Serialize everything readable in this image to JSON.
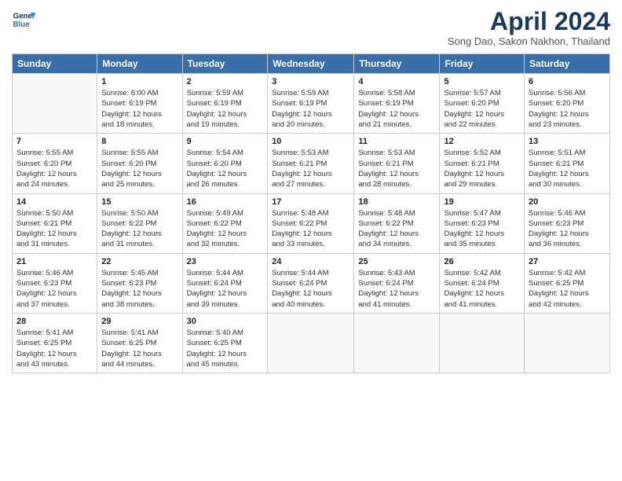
{
  "logo": {
    "line1": "General",
    "line2": "Blue"
  },
  "title": "April 2024",
  "subtitle": "Song Dao, Sakon Nakhon, Thailand",
  "days_of_week": [
    "Sunday",
    "Monday",
    "Tuesday",
    "Wednesday",
    "Thursday",
    "Friday",
    "Saturday"
  ],
  "weeks": [
    [
      {
        "day": "",
        "info": ""
      },
      {
        "day": "1",
        "info": "Sunrise: 6:00 AM\nSunset: 6:19 PM\nDaylight: 12 hours\nand 18 minutes."
      },
      {
        "day": "2",
        "info": "Sunrise: 5:59 AM\nSunset: 6:19 PM\nDaylight: 12 hours\nand 19 minutes."
      },
      {
        "day": "3",
        "info": "Sunrise: 5:59 AM\nSunset: 6:19 PM\nDaylight: 12 hours\nand 20 minutes."
      },
      {
        "day": "4",
        "info": "Sunrise: 5:58 AM\nSunset: 6:19 PM\nDaylight: 12 hours\nand 21 minutes."
      },
      {
        "day": "5",
        "info": "Sunrise: 5:57 AM\nSunset: 6:20 PM\nDaylight: 12 hours\nand 22 minutes."
      },
      {
        "day": "6",
        "info": "Sunrise: 5:56 AM\nSunset: 6:20 PM\nDaylight: 12 hours\nand 23 minutes."
      }
    ],
    [
      {
        "day": "7",
        "info": "Sunrise: 5:55 AM\nSunset: 6:20 PM\nDaylight: 12 hours\nand 24 minutes."
      },
      {
        "day": "8",
        "info": "Sunrise: 5:55 AM\nSunset: 6:20 PM\nDaylight: 12 hours\nand 25 minutes."
      },
      {
        "day": "9",
        "info": "Sunrise: 5:54 AM\nSunset: 6:20 PM\nDaylight: 12 hours\nand 26 minutes."
      },
      {
        "day": "10",
        "info": "Sunrise: 5:53 AM\nSunset: 6:21 PM\nDaylight: 12 hours\nand 27 minutes."
      },
      {
        "day": "11",
        "info": "Sunrise: 5:53 AM\nSunset: 6:21 PM\nDaylight: 12 hours\nand 28 minutes."
      },
      {
        "day": "12",
        "info": "Sunrise: 5:52 AM\nSunset: 6:21 PM\nDaylight: 12 hours\nand 29 minutes."
      },
      {
        "day": "13",
        "info": "Sunrise: 5:51 AM\nSunset: 6:21 PM\nDaylight: 12 hours\nand 30 minutes."
      }
    ],
    [
      {
        "day": "14",
        "info": "Sunrise: 5:50 AM\nSunset: 6:21 PM\nDaylight: 12 hours\nand 31 minutes."
      },
      {
        "day": "15",
        "info": "Sunrise: 5:50 AM\nSunset: 6:22 PM\nDaylight: 12 hours\nand 31 minutes."
      },
      {
        "day": "16",
        "info": "Sunrise: 5:49 AM\nSunset: 6:22 PM\nDaylight: 12 hours\nand 32 minutes."
      },
      {
        "day": "17",
        "info": "Sunrise: 5:48 AM\nSunset: 6:22 PM\nDaylight: 12 hours\nand 33 minutes."
      },
      {
        "day": "18",
        "info": "Sunrise: 5:48 AM\nSunset: 6:22 PM\nDaylight: 12 hours\nand 34 minutes."
      },
      {
        "day": "19",
        "info": "Sunrise: 5:47 AM\nSunset: 6:23 PM\nDaylight: 12 hours\nand 35 minutes."
      },
      {
        "day": "20",
        "info": "Sunrise: 5:46 AM\nSunset: 6:23 PM\nDaylight: 12 hours\nand 36 minutes."
      }
    ],
    [
      {
        "day": "21",
        "info": "Sunrise: 5:46 AM\nSunset: 6:23 PM\nDaylight: 12 hours\nand 37 minutes."
      },
      {
        "day": "22",
        "info": "Sunrise: 5:45 AM\nSunset: 6:23 PM\nDaylight: 12 hours\nand 38 minutes."
      },
      {
        "day": "23",
        "info": "Sunrise: 5:44 AM\nSunset: 6:24 PM\nDaylight: 12 hours\nand 39 minutes."
      },
      {
        "day": "24",
        "info": "Sunrise: 5:44 AM\nSunset: 6:24 PM\nDaylight: 12 hours\nand 40 minutes."
      },
      {
        "day": "25",
        "info": "Sunrise: 5:43 AM\nSunset: 6:24 PM\nDaylight: 12 hours\nand 41 minutes."
      },
      {
        "day": "26",
        "info": "Sunrise: 5:42 AM\nSunset: 6:24 PM\nDaylight: 12 hours\nand 41 minutes."
      },
      {
        "day": "27",
        "info": "Sunrise: 5:42 AM\nSunset: 6:25 PM\nDaylight: 12 hours\nand 42 minutes."
      }
    ],
    [
      {
        "day": "28",
        "info": "Sunrise: 5:41 AM\nSunset: 6:25 PM\nDaylight: 12 hours\nand 43 minutes."
      },
      {
        "day": "29",
        "info": "Sunrise: 5:41 AM\nSunset: 6:25 PM\nDaylight: 12 hours\nand 44 minutes."
      },
      {
        "day": "30",
        "info": "Sunrise: 5:40 AM\nSunset: 6:25 PM\nDaylight: 12 hours\nand 45 minutes."
      },
      {
        "day": "",
        "info": ""
      },
      {
        "day": "",
        "info": ""
      },
      {
        "day": "",
        "info": ""
      },
      {
        "day": "",
        "info": ""
      }
    ]
  ]
}
